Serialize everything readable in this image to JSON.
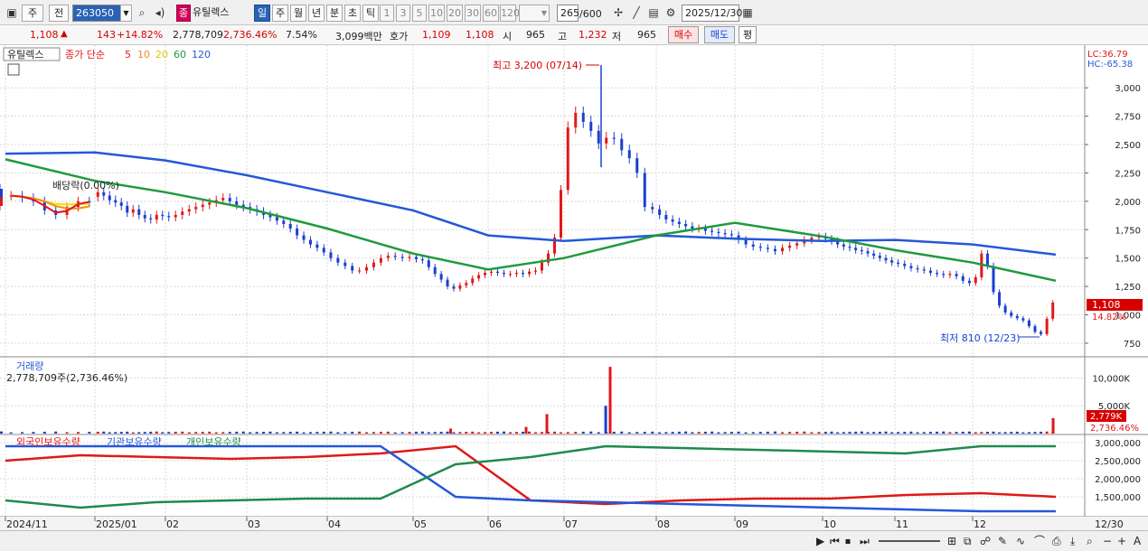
{
  "toolbar": {
    "period_type": "주",
    "prev_label": "전",
    "stock_code": "263050",
    "mode_tag": "종",
    "stock_name": "유틸렉스",
    "periods": [
      "일",
      "주",
      "월",
      "년",
      "분",
      "초",
      "틱"
    ],
    "selected_period": "일",
    "intervals": [
      "1",
      "3",
      "5",
      "10",
      "20",
      "30",
      "60",
      "120"
    ],
    "count": "265",
    "count_total": "/600",
    "date": "2025/12/30"
  },
  "quote": {
    "price": "1,108",
    "change": "143",
    "change_pct": "+14.82%",
    "volume": "2,778,709",
    "volume_ratio": "2,736.46%",
    "turnover": "7.54%",
    "amount": "3,099백만",
    "hoga_label": "호가",
    "ask": "1,109",
    "bid": "1,108",
    "open_label": "시",
    "open": "965",
    "high_label": "고",
    "high": "1,232",
    "low_label": "저",
    "low": "965",
    "buy_label": "매수",
    "sell_label": "매도",
    "eval_label": "평"
  },
  "chart_data": [
    {
      "type": "line",
      "title": "유틸렉스",
      "legend": {
        "label": "종가 단순",
        "mas": [
          "5",
          "10",
          "20",
          "60",
          "120"
        ],
        "colors": [
          "#e01818",
          "#f08a1c",
          "#f2e600",
          "#1f9a3e",
          "#2458d8"
        ]
      },
      "lc": "LC:36.79",
      "hc": "HC:-65.38",
      "y_ticks": [
        750,
        1000,
        1250,
        1500,
        1750,
        2000,
        2250,
        2500,
        2750,
        3000
      ],
      "y_tick_labels": [
        "750",
        "1,000",
        "1,250",
        "1,500",
        "1,750",
        "2,000",
        "2,250",
        "2,500",
        "2,750",
        "3,000"
      ],
      "ylim": [
        670,
        3280
      ],
      "high_note": "최고 3,200 (07/14)",
      "low_note": "최저 810 (12/23)",
      "dividend_note": "배당락(0.00%)",
      "last_price": "1,108",
      "last_pct": "14.82%",
      "x_labels": [
        "2024/11",
        "2025/01",
        "02",
        "03",
        "04",
        "05",
        "06",
        "07",
        "08",
        "09",
        "10",
        "11",
        "12",
        "12/30"
      ],
      "close_series": [
        {
          "m": "2024-11",
          "v": [
            2050,
            2030,
            2000,
            1920,
            1880,
            1950,
            2000,
            1990
          ]
        },
        {
          "m": "2024-12",
          "v": [
            2050,
            2040,
            2080,
            2000,
            2060,
            2110,
            2090,
            1970,
            1960,
            2020,
            2060,
            2040
          ]
        },
        {
          "m": "2025-01",
          "v": [
            2080,
            2050,
            2010,
            1990,
            1960,
            1900,
            1930,
            1880,
            1850,
            1840,
            1880,
            1870
          ]
        },
        {
          "m": "2025-02",
          "v": [
            1860,
            1880,
            1910,
            1930,
            1950,
            1970,
            1990,
            2010,
            2030,
            2000,
            1970,
            1950
          ]
        },
        {
          "m": "2025-03",
          "v": [
            1930,
            1910,
            1880,
            1860,
            1830,
            1800,
            1760,
            1700,
            1660,
            1620,
            1590,
            1550
          ]
        },
        {
          "m": "2025-04",
          "v": [
            1500,
            1460,
            1430,
            1390,
            1390,
            1420,
            1460,
            1500,
            1520,
            1510,
            1500,
            1510
          ]
        },
        {
          "m": "2025-05",
          "v": [
            1490,
            1480,
            1420,
            1360,
            1310,
            1250,
            1230,
            1260,
            1280,
            1320,
            1350,
            1370
          ]
        },
        {
          "m": "2025-06",
          "v": [
            1380,
            1370,
            1360,
            1360,
            1370,
            1360,
            1380,
            1390,
            1460,
            1540,
            1680,
            2100
          ]
        },
        {
          "m": "2025-07",
          "v": [
            2650,
            2780,
            2700,
            2620,
            2510,
            2560,
            2550,
            2450,
            2380,
            2250,
            1950,
            1930
          ]
        },
        {
          "m": "2025-08",
          "v": [
            1880,
            1840,
            1820,
            1800,
            1780,
            1760,
            1760,
            1740,
            1730,
            1720,
            1710,
            1700
          ]
        },
        {
          "m": "2025-09",
          "v": [
            1660,
            1620,
            1600,
            1590,
            1580,
            1560,
            1590,
            1610,
            1630,
            1660,
            1680,
            1690
          ]
        },
        {
          "m": "2025-10",
          "v": [
            1670,
            1650,
            1620,
            1600,
            1590,
            1570,
            1560,
            1540,
            1520,
            1500,
            1480,
            1460
          ]
        },
        {
          "m": "2025-11",
          "v": [
            1450,
            1430,
            1410,
            1400,
            1390,
            1370,
            1360,
            1350,
            1360,
            1340,
            1300,
            1280
          ]
        },
        {
          "m": "2025-12",
          "v": [
            1330,
            1540,
            1430,
            1200,
            1080,
            1020,
            990,
            970,
            950,
            900,
            850,
            830,
            965,
            1108
          ]
        }
      ],
      "ma120": [
        {
          "m": "2024-11",
          "v": 2420
        },
        {
          "m": "2025-01",
          "v": 2430
        },
        {
          "m": "2025-02",
          "v": 2360
        },
        {
          "m": "2025-03",
          "v": 2230
        },
        {
          "m": "2025-04",
          "v": 2080
        },
        {
          "m": "2025-05",
          "v": 1920
        },
        {
          "m": "2025-06",
          "v": 1700
        },
        {
          "m": "2025-07",
          "v": 1650
        },
        {
          "m": "2025-08",
          "v": 1700
        },
        {
          "m": "2025-09",
          "v": 1670
        },
        {
          "m": "2025-10",
          "v": 1650
        },
        {
          "m": "2025-11",
          "v": 1660
        },
        {
          "m": "2025-12",
          "v": 1620
        },
        {
          "m": "2025-12-30",
          "v": 1530
        }
      ],
      "ma60": [
        {
          "m": "2024-11",
          "v": 2370
        },
        {
          "m": "2025-01",
          "v": 2180
        },
        {
          "m": "2025-02",
          "v": 2080
        },
        {
          "m": "2025-03",
          "v": 1940
        },
        {
          "m": "2025-04",
          "v": 1760
        },
        {
          "m": "2025-05",
          "v": 1540
        },
        {
          "m": "2025-06",
          "v": 1400
        },
        {
          "m": "2025-07",
          "v": 1500
        },
        {
          "m": "2025-08",
          "v": 1700
        },
        {
          "m": "2025-09",
          "v": 1810
        },
        {
          "m": "2025-10",
          "v": 1690
        },
        {
          "m": "2025-11",
          "v": 1570
        },
        {
          "m": "2025-12",
          "v": 1460
        },
        {
          "m": "2025-12-30",
          "v": 1300
        }
      ]
    },
    {
      "type": "bar",
      "title": "거래량",
      "subtitle": "2,778,709주(2,736.46%)",
      "y_tick_labels": [
        "5,000K",
        "10,000K"
      ],
      "last": "2,779K",
      "last_pct": "2,736.46%",
      "spikes": [
        {
          "m": "2025-05",
          "v": 900
        },
        {
          "m": "2025-06",
          "v": 1200
        },
        {
          "m": "2025-06-24",
          "v": 3500
        },
        {
          "m": "2025-07",
          "v": 12000
        },
        {
          "m": "2025-07-14",
          "v": 5000
        },
        {
          "m": "2025-12-30",
          "v": 2779
        }
      ]
    },
    {
      "type": "line",
      "series": [
        {
          "name": "외국인보유수량",
          "color": "#e01818"
        },
        {
          "name": "기관보유수량",
          "color": "#2458d8"
        },
        {
          "name": "개인보유수량",
          "color": "#1f8a4e"
        }
      ],
      "y_tick_labels": [
        "1,500,000",
        "2,000,000",
        "2,500,000",
        "3,000,000"
      ],
      "foreign": [
        2500000,
        2650000,
        2600000,
        2550000,
        2600000,
        2700000,
        2900000,
        1400000,
        1300000,
        1400000,
        1450000,
        1450000,
        1550000,
        1600000,
        1500000
      ],
      "institution": [
        2900000,
        2900000,
        2900000,
        2900000,
        2900000,
        2900000,
        1500000,
        1400000,
        1350000,
        1300000,
        1250000,
        1200000,
        1150000,
        1100000,
        1100000
      ],
      "individual": [
        1400000,
        1200000,
        1350000,
        1400000,
        1450000,
        1450000,
        2400000,
        2600000,
        2900000,
        2850000,
        2800000,
        2750000,
        2700000,
        2900000,
        2900000
      ]
    }
  ],
  "bottom": {
    "controls": [
      "▶",
      "⏮",
      "⏹",
      "⏭"
    ]
  }
}
